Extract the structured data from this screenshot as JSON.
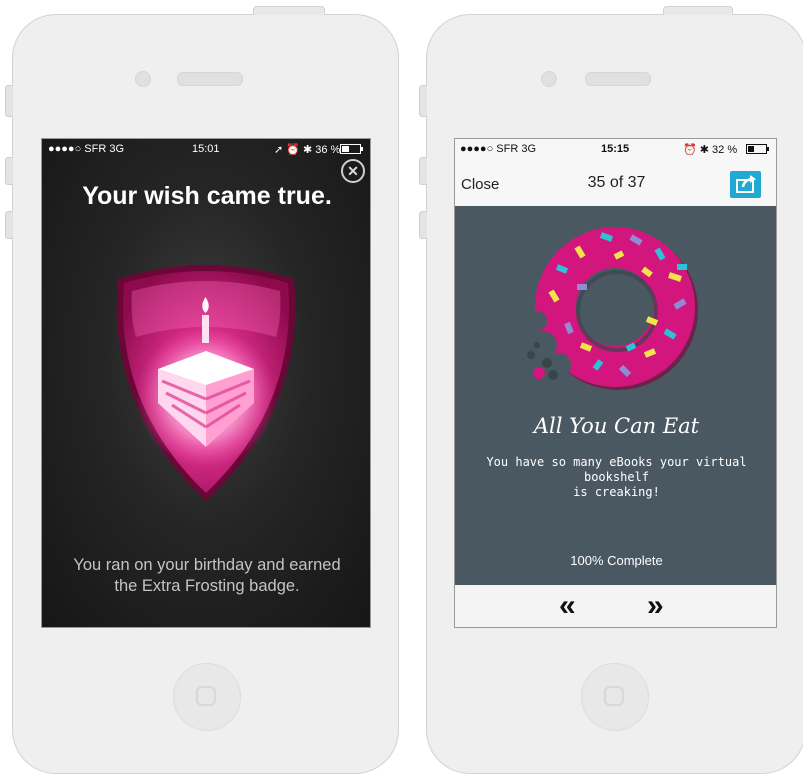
{
  "left_screen": {
    "status": {
      "carrier": "●●●●○ SFR  3G",
      "time": "15:01",
      "battery": "➚ ⏰ ✱ 36 %"
    },
    "close_icon": "close-icon",
    "title": "Your wish came true.",
    "badge_icon": "cake-slice-shield-badge",
    "message_line1": "You ran on your birthday and earned",
    "message_line2": "the Extra Frosting badge."
  },
  "right_screen": {
    "status": {
      "carrier": "●●●●○ SFR  3G",
      "time": "15:15",
      "battery": "⏰ ✱ 32 %"
    },
    "close_label": "Close",
    "page_indicator": "35 of 37",
    "share_icon": "share-icon",
    "badge_icon": "donut-badge",
    "title": "All You Can Eat",
    "description_line1": "You have so many eBooks your virtual bookshelf",
    "description_line2": "is creaking!",
    "progress_text": "100% Complete",
    "prev_label": "«",
    "next_label": "»"
  },
  "colors": {
    "badge_pink": "#d4127a",
    "donut_pink": "#d3157e",
    "share_blue": "#21a8d3",
    "right_background": "#4a5862"
  }
}
